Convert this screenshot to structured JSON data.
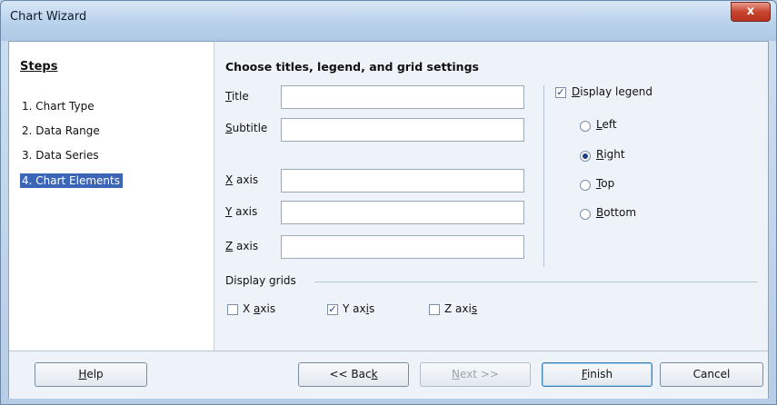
{
  "window": {
    "title": "Chart Wizard",
    "close_label": "x"
  },
  "steps": {
    "heading": "Steps",
    "items": [
      {
        "label": "1. Chart Type",
        "active": false
      },
      {
        "label": "2. Data Range",
        "active": false
      },
      {
        "label": "3. Data Series",
        "active": false
      },
      {
        "label": "4. Chart Elements",
        "active": true
      }
    ]
  },
  "main": {
    "heading": "Choose titles, legend, and grid settings",
    "fields": {
      "title": {
        "label": "Title",
        "value": ""
      },
      "subtitle": {
        "label": "Subtitle",
        "value": ""
      },
      "x_axis": {
        "label": "X axis",
        "value": ""
      },
      "y_axis": {
        "label": "Y axis",
        "value": ""
      },
      "z_axis": {
        "label": "Z axis",
        "value": ""
      }
    },
    "legend": {
      "display_label": "Display legend",
      "display_checked": true,
      "options": [
        {
          "label": "Left",
          "selected": false
        },
        {
          "label": "Right",
          "selected": true
        },
        {
          "label": "Top",
          "selected": false
        },
        {
          "label": "Bottom",
          "selected": false
        }
      ]
    },
    "grids": {
      "label": "Display grids",
      "x": {
        "label": "X axis",
        "checked": false
      },
      "y": {
        "label": "Y axis",
        "checked": true
      },
      "z": {
        "label": "Z axis",
        "checked": false
      }
    }
  },
  "footer": {
    "help": "Help",
    "back": "<< Back",
    "next": "Next >>",
    "finish": "Finish",
    "cancel": "Cancel"
  },
  "colors": {
    "accent": "#3b66b8",
    "check": "#1e3f86"
  }
}
